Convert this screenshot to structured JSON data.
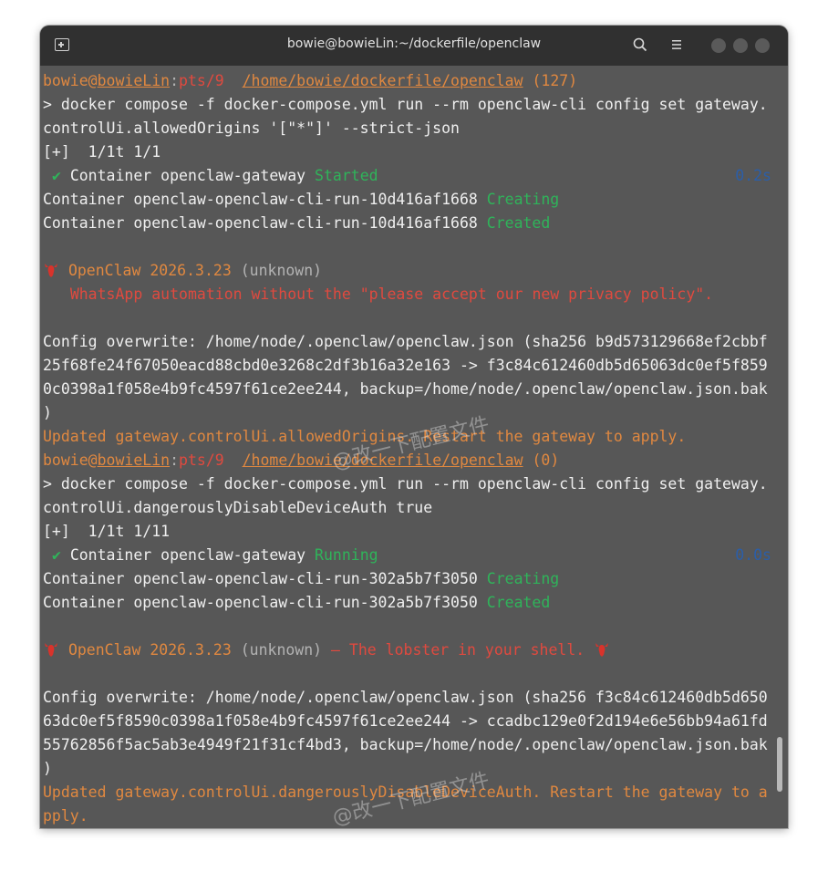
{
  "window": {
    "title": "bowie@bowieLin:~/dockerfile/openclaw"
  },
  "watermark": "@改一下配置文件",
  "colors": {
    "prompt": "#e08840",
    "warning": "#e04a3f",
    "success": "#2fb45a",
    "timing": "#2b5ea8"
  },
  "icons": {
    "new_tab": "new-tab-icon",
    "search": "search-icon",
    "menu": "hamburger-menu-icon",
    "app": "lobster-icon"
  },
  "blocks": [
    {
      "prompt": {
        "user": "bowie",
        "at": "@",
        "host": "bowieLin",
        "colon": ":",
        "tty": "pts/9",
        "path": "/home/bowie/dockerfile/openclaw",
        "status": "(127)"
      },
      "command_1": "> docker compose -f docker-compose.yml run --rm openclaw-cli config set gateway.",
      "command_2": "controlUi.allowedOrigins '[\"*\"]' --strict-json",
      "progress": "[+]  1/1t 1/1",
      "check": "✔",
      "gateway_label": "Container openclaw-gateway",
      "gateway_status": "Started",
      "gateway_time": "0.2s",
      "cli_label": "Container openclaw-openclaw-cli-run-10d416af1668",
      "cli_status_1": "Creating",
      "cli_status_2": "Created",
      "app_name": "OpenClaw",
      "version": "2026.3.23",
      "unknown": "(unknown)",
      "tagline": "",
      "tagline_2": "WhatsApp automation without the \"please accept our new privacy policy\".",
      "config_lines": [
        "Config overwrite: /home/node/.openclaw/openclaw.json (sha256 b9d573129668ef2cbbf",
        "25f68fe24f67050eacd88cbd0e3268c2df3b16a32e163 -> f3c84c612460db5d65063dc0ef5f859",
        "0c0398a1f058e4b9fc4597f61ce2ee244, backup=/home/node/.openclaw/openclaw.json.bak",
        ")"
      ],
      "updated_lines": [
        "Updated gateway.controlUi.allowedOrigins. Restart the gateway to apply."
      ]
    },
    {
      "prompt": {
        "user": "bowie",
        "at": "@",
        "host": "bowieLin",
        "colon": ":",
        "tty": "pts/9",
        "path": "/home/bowie/dockerfile/openclaw",
        "status": "(0)"
      },
      "command_1": "> docker compose -f docker-compose.yml run --rm openclaw-cli config set gateway.",
      "command_2": "controlUi.dangerouslyDisableDeviceAuth true",
      "progress": "[+]  1/1t 1/11",
      "check": "✔",
      "gateway_label": "Container openclaw-gateway",
      "gateway_status": "Running",
      "gateway_time": "0.0s",
      "cli_label": "Container openclaw-openclaw-cli-run-302a5b7f3050",
      "cli_status_1": "Creating",
      "cli_status_2": "Created",
      "app_name": "OpenClaw",
      "version": "2026.3.23",
      "unknown": "(unknown)",
      "tagline": "— The lobster in your shell.",
      "config_lines": [
        "Config overwrite: /home/node/.openclaw/openclaw.json (sha256 f3c84c612460db5d650",
        "63dc0ef5f8590c0398a1f058e4b9fc4597f61ce2ee244 -> ccadbc129e0f2d194e6e56bb94a61fd",
        "55762856f5ac5ab3e4949f21f31cf4bd3, backup=/home/node/.openclaw/openclaw.json.bak",
        ")"
      ],
      "updated_lines": [
        "Updated gateway.controlUi.dangerouslyDisableDeviceAuth. Restart the gateway to a",
        "pply."
      ]
    }
  ]
}
